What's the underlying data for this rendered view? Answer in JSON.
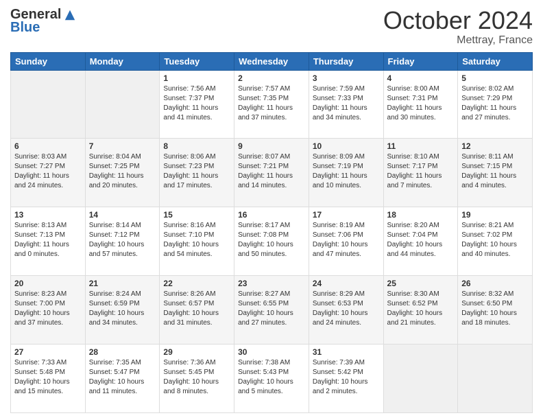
{
  "header": {
    "logo_general": "General",
    "logo_blue": "Blue",
    "month_title": "October 2024",
    "location": "Mettray, France"
  },
  "days_of_week": [
    "Sunday",
    "Monday",
    "Tuesday",
    "Wednesday",
    "Thursday",
    "Friday",
    "Saturday"
  ],
  "weeks": [
    [
      {
        "day": "",
        "info": ""
      },
      {
        "day": "",
        "info": ""
      },
      {
        "day": "1",
        "info": "Sunrise: 7:56 AM\nSunset: 7:37 PM\nDaylight: 11 hours and 41 minutes."
      },
      {
        "day": "2",
        "info": "Sunrise: 7:57 AM\nSunset: 7:35 PM\nDaylight: 11 hours and 37 minutes."
      },
      {
        "day": "3",
        "info": "Sunrise: 7:59 AM\nSunset: 7:33 PM\nDaylight: 11 hours and 34 minutes."
      },
      {
        "day": "4",
        "info": "Sunrise: 8:00 AM\nSunset: 7:31 PM\nDaylight: 11 hours and 30 minutes."
      },
      {
        "day": "5",
        "info": "Sunrise: 8:02 AM\nSunset: 7:29 PM\nDaylight: 11 hours and 27 minutes."
      }
    ],
    [
      {
        "day": "6",
        "info": "Sunrise: 8:03 AM\nSunset: 7:27 PM\nDaylight: 11 hours and 24 minutes."
      },
      {
        "day": "7",
        "info": "Sunrise: 8:04 AM\nSunset: 7:25 PM\nDaylight: 11 hours and 20 minutes."
      },
      {
        "day": "8",
        "info": "Sunrise: 8:06 AM\nSunset: 7:23 PM\nDaylight: 11 hours and 17 minutes."
      },
      {
        "day": "9",
        "info": "Sunrise: 8:07 AM\nSunset: 7:21 PM\nDaylight: 11 hours and 14 minutes."
      },
      {
        "day": "10",
        "info": "Sunrise: 8:09 AM\nSunset: 7:19 PM\nDaylight: 11 hours and 10 minutes."
      },
      {
        "day": "11",
        "info": "Sunrise: 8:10 AM\nSunset: 7:17 PM\nDaylight: 11 hours and 7 minutes."
      },
      {
        "day": "12",
        "info": "Sunrise: 8:11 AM\nSunset: 7:15 PM\nDaylight: 11 hours and 4 minutes."
      }
    ],
    [
      {
        "day": "13",
        "info": "Sunrise: 8:13 AM\nSunset: 7:13 PM\nDaylight: 11 hours and 0 minutes."
      },
      {
        "day": "14",
        "info": "Sunrise: 8:14 AM\nSunset: 7:12 PM\nDaylight: 10 hours and 57 minutes."
      },
      {
        "day": "15",
        "info": "Sunrise: 8:16 AM\nSunset: 7:10 PM\nDaylight: 10 hours and 54 minutes."
      },
      {
        "day": "16",
        "info": "Sunrise: 8:17 AM\nSunset: 7:08 PM\nDaylight: 10 hours and 50 minutes."
      },
      {
        "day": "17",
        "info": "Sunrise: 8:19 AM\nSunset: 7:06 PM\nDaylight: 10 hours and 47 minutes."
      },
      {
        "day": "18",
        "info": "Sunrise: 8:20 AM\nSunset: 7:04 PM\nDaylight: 10 hours and 44 minutes."
      },
      {
        "day": "19",
        "info": "Sunrise: 8:21 AM\nSunset: 7:02 PM\nDaylight: 10 hours and 40 minutes."
      }
    ],
    [
      {
        "day": "20",
        "info": "Sunrise: 8:23 AM\nSunset: 7:00 PM\nDaylight: 10 hours and 37 minutes."
      },
      {
        "day": "21",
        "info": "Sunrise: 8:24 AM\nSunset: 6:59 PM\nDaylight: 10 hours and 34 minutes."
      },
      {
        "day": "22",
        "info": "Sunrise: 8:26 AM\nSunset: 6:57 PM\nDaylight: 10 hours and 31 minutes."
      },
      {
        "day": "23",
        "info": "Sunrise: 8:27 AM\nSunset: 6:55 PM\nDaylight: 10 hours and 27 minutes."
      },
      {
        "day": "24",
        "info": "Sunrise: 8:29 AM\nSunset: 6:53 PM\nDaylight: 10 hours and 24 minutes."
      },
      {
        "day": "25",
        "info": "Sunrise: 8:30 AM\nSunset: 6:52 PM\nDaylight: 10 hours and 21 minutes."
      },
      {
        "day": "26",
        "info": "Sunrise: 8:32 AM\nSunset: 6:50 PM\nDaylight: 10 hours and 18 minutes."
      }
    ],
    [
      {
        "day": "27",
        "info": "Sunrise: 7:33 AM\nSunset: 5:48 PM\nDaylight: 10 hours and 15 minutes."
      },
      {
        "day": "28",
        "info": "Sunrise: 7:35 AM\nSunset: 5:47 PM\nDaylight: 10 hours and 11 minutes."
      },
      {
        "day": "29",
        "info": "Sunrise: 7:36 AM\nSunset: 5:45 PM\nDaylight: 10 hours and 8 minutes."
      },
      {
        "day": "30",
        "info": "Sunrise: 7:38 AM\nSunset: 5:43 PM\nDaylight: 10 hours and 5 minutes."
      },
      {
        "day": "31",
        "info": "Sunrise: 7:39 AM\nSunset: 5:42 PM\nDaylight: 10 hours and 2 minutes."
      },
      {
        "day": "",
        "info": ""
      },
      {
        "day": "",
        "info": ""
      }
    ]
  ]
}
